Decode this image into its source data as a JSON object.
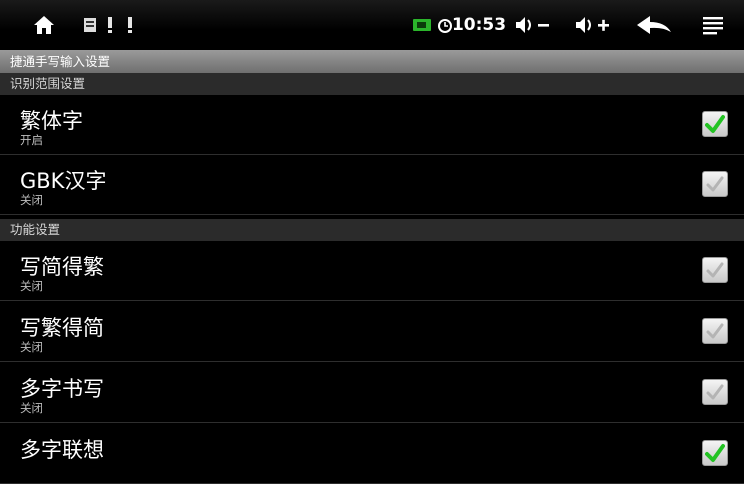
{
  "status_bar": {
    "time": "10:53",
    "icons": [
      "home-icon",
      "notification-icon",
      "warning-icon",
      "warning-icon",
      "battery-icon",
      "alarm-icon",
      "volume-down-icon",
      "volume-up-icon",
      "back-icon",
      "menu-icon"
    ],
    "volume_down_label": "◀)−",
    "volume_up_label": "◀)+"
  },
  "title": "捷通手写输入设置",
  "sections": [
    {
      "header": "识别范围设置",
      "items": [
        {
          "title": "繁体字",
          "summary": "开启",
          "checked": true
        },
        {
          "title": "GBK汉字",
          "summary": "关闭",
          "checked": false
        }
      ]
    },
    {
      "header": "功能设置",
      "items": [
        {
          "title": "写简得繁",
          "summary": "关闭",
          "checked": false
        },
        {
          "title": "写繁得简",
          "summary": "关闭",
          "checked": false
        },
        {
          "title": "多字书写",
          "summary": "关闭",
          "checked": false
        },
        {
          "title": "多字联想",
          "summary": "",
          "checked": true
        }
      ]
    }
  ],
  "colors": {
    "check_on": "#2ecc2e",
    "check_off": "#9a9a9a"
  }
}
